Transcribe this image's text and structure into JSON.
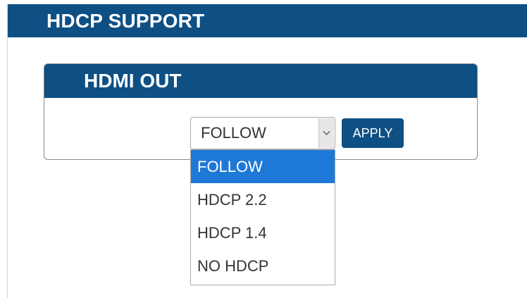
{
  "section": {
    "title": "HDCP SUPPORT"
  },
  "card": {
    "title": "HDMI OUT",
    "select": {
      "value": "FOLLOW",
      "options": [
        "FOLLOW",
        "HDCP 2.2",
        "HDCP 1.4",
        "NO HDCP"
      ],
      "selected_index": 0
    },
    "apply_label": "APPLY"
  },
  "colors": {
    "header_bg": "#0e4f84",
    "selected_option_bg": "#1e78d8"
  },
  "icons": {
    "select_arrow": "chevron-down-icon"
  }
}
